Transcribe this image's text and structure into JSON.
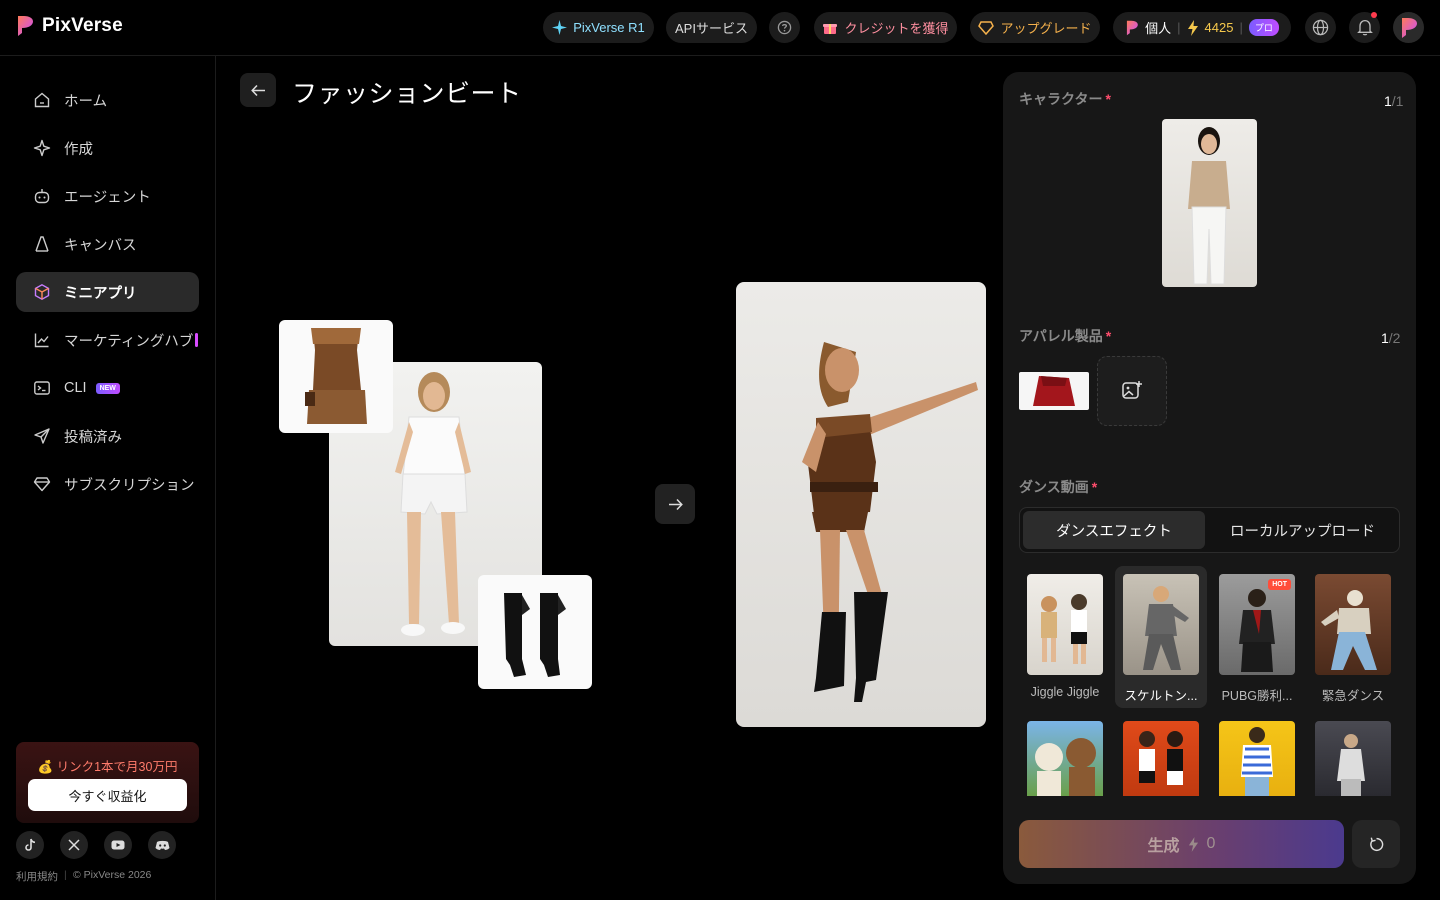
{
  "app": {
    "name": "PixVerse"
  },
  "topbar": {
    "model_label": "PixVerse R1",
    "api_label": "APIサービス",
    "credits_label": "クレジットを獲得",
    "upgrade_label": "アップグレード",
    "account_type": "個人",
    "credit_count": "4425",
    "plan_badge": "プロ"
  },
  "sidebar": {
    "items": [
      {
        "label": "ホーム",
        "icon": "home-icon"
      },
      {
        "label": "作成",
        "icon": "sparkle-icon"
      },
      {
        "label": "エージェント",
        "icon": "robot-icon"
      },
      {
        "label": "キャンバス",
        "icon": "canvas-icon"
      },
      {
        "label": "ミニアプリ",
        "icon": "cube-icon",
        "active": true
      },
      {
        "label": "マーケティングハブ",
        "icon": "chart-icon"
      },
      {
        "label": "CLI",
        "icon": "terminal-icon",
        "badge": "NEW"
      },
      {
        "label": "投稿済み",
        "icon": "send-icon"
      },
      {
        "label": "サブスクリプション",
        "icon": "diamond-icon"
      }
    ],
    "promo_text": "💰 リンク1本で月30万円",
    "promo_button": "今すぐ収益化",
    "terms": "利用規約",
    "copyright": "© PixVerse 2026"
  },
  "main": {
    "title": "ファッションビート"
  },
  "panel": {
    "character": {
      "label": "キャラクター",
      "current": "1",
      "total": "/1"
    },
    "apparel": {
      "label": "アパレル製品",
      "current": "1",
      "total": "/2"
    },
    "dance": {
      "label": "ダンス動画",
      "tabs": [
        "ダンスエフェクト",
        "ローカルアップロード"
      ],
      "items": [
        {
          "label": "Jiggle Jiggle"
        },
        {
          "label": "スケルトン..."
        },
        {
          "label": "PUBG勝利...",
          "badge": "HOT"
        },
        {
          "label": "緊急ダンス"
        }
      ]
    },
    "generate_label": "生成",
    "generate_cost": "0"
  },
  "colors": {
    "accent_pink": "#d84cff",
    "required": "#ff4d6d",
    "credit": "#f5c84c"
  }
}
